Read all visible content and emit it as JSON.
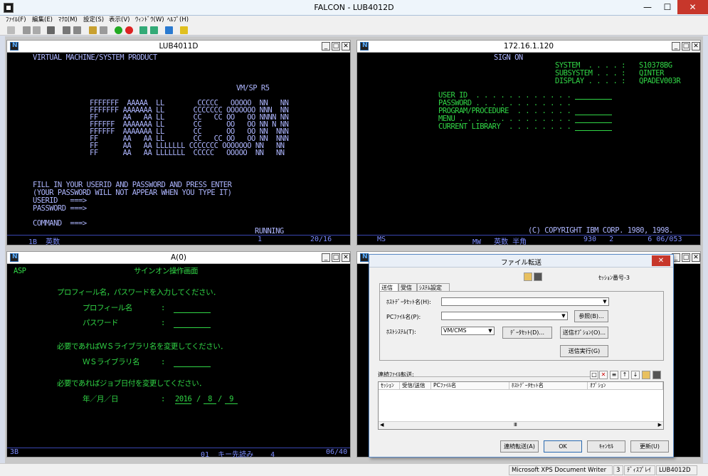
{
  "app": {
    "title": "FALCON - LUB4012D"
  },
  "menu": [
    "ﾌｧｲﾙ(F)",
    "編集(E)",
    "ﾏｸﾛ(M)",
    "設定(S)",
    "表示(V)",
    "ｳｨﾝﾄﾞｳ(W)",
    "ﾍﾙﾌﾟ(H)"
  ],
  "windows": {
    "w1": {
      "title": "LUB4011D",
      "header": "VIRTUAL MACHINE/SYSTEM PRODUCT",
      "version": "VM/SP R5",
      "logo": [
        "FFFFFFF  AAAAA  LL        CCCCC   OOOOO  NN   NN",
        "FFFFFFF AAAAAAA LL       CCCCCCC OOOOOOO NNN  NN",
        "FF      AA   AA LL       CC   CC OO   OO NNNN NN",
        "FFFFFF  AAAAAAA LL       CC      OO   OO NN N NN",
        "FFFFFF  AAAAAAA LL       CC      OO   OO NN  NNN",
        "FF      AA   AA LL       CC   CC OO   OO NN  NNN",
        "FF      AA   AA LLLLLLL CCCCCCC OOOOOOO NN   NN",
        "FF      AA   AA LLLLLLL  CCCCC   OOOOO  NN   NN"
      ],
      "msg1": "FILL IN YOUR USERID AND PASSWORD AND PRESS ENTER",
      "msg2": "(YOUR PASSWORD WILL NOT APPEAR WHEN YOU TYPE IT)",
      "userid": "USERID   ===>",
      "password": "PASSWORD ===>",
      "command": "COMMAND  ===>",
      "running": "RUNNING",
      "status_left": "1B  英数",
      "status_mid": "1",
      "status_right": "20/16"
    },
    "w2": {
      "title": "172.16.1.120",
      "header": "SIGN ON",
      "sys_labels": [
        "SYSTEM  . . . . :",
        "SUBSYSTEM . . . :",
        "DISPLAY . . . . :"
      ],
      "sys_values": [
        "S10378BG",
        "QINTER",
        "QPADEV003R"
      ],
      "fields": [
        "USER ID  . . . . . . . . . . . .",
        "PASSWORD . . . . . . . . . . . .",
        "PROGRAM/PROCEDURE  . . . . . . .",
        "MENU . . . . . . . . . . . . . .",
        "CURRENT LIBRARY  . . . . . . . ."
      ],
      "copyright": "(C) COPYRIGHT IBM CORP. 1980, 1998.",
      "status_left": "MS",
      "status_mid": "MW   英数 半角",
      "status_right": "930   2        6 06/053"
    },
    "w3": {
      "title": "A(0)",
      "asp": "ASP",
      "header": "サインオン操作画面",
      "msg1": "プロフィール名，パスワードを入力してください．",
      "profile": "プロフィール名",
      "password": "パスワード",
      "colon": ":",
      "msg2": "必要であればＷＳライブラリ名を変更してください．",
      "wslib": "ＷＳライブラリ名",
      "msg3": "必要であればジョブ日付を変更してください．",
      "date_label": "年／月／日",
      "year": "2016",
      "month": "8",
      "day": "9",
      "slash": "/",
      "status_left": "3B",
      "status_mid": "01  キー先読み    4",
      "status_right": "06/40"
    },
    "w4": {
      "title": ""
    }
  },
  "dialog": {
    "title": "ファイル転送",
    "session": "ｾｯｼｮﾝ番号-3",
    "tabs": [
      "送信",
      "受信",
      "ｼｽﾃﾑ設定"
    ],
    "host_dataset_label": "ﾎｽﾄﾃﾞｰﾀｾｯﾄ名(H):",
    "pc_file_label": "PCﾌｧｲﾙ名(P):",
    "host_system_label": "ﾎｽﾄｼｽﾃﾑ(T):",
    "host_system_value": "VM/CMS",
    "browse": "参照(B)...",
    "dataset_btn": "ﾃﾞｰﾀｾｯﾄ(D)...",
    "send_option_btn": "送信ｵﾌﾟｼｮﾝ(O)...",
    "send_exec_btn": "送信実行(G)",
    "continuous_label": "連続ﾌｧｲﾙ転送:",
    "columns": [
      "ｾｯｼｮﾝ",
      "受信/送信",
      "PCﾌｧｲﾙ名",
      "ﾎｽﾄﾃﾞｰﾀｾｯﾄ名",
      "ｵﾌﾟｼｮﾝ"
    ],
    "buttons": [
      "連続転送(A)",
      "OK",
      "ｷｬﾝｾﾙ",
      "更新(U)"
    ]
  },
  "statusbar": {
    "printer": "Microsoft XPS Document Writer",
    "num": "3",
    "display": "ﾃﾞｨｽﾌﾟﾚｲ",
    "session": "LUB4012D"
  }
}
